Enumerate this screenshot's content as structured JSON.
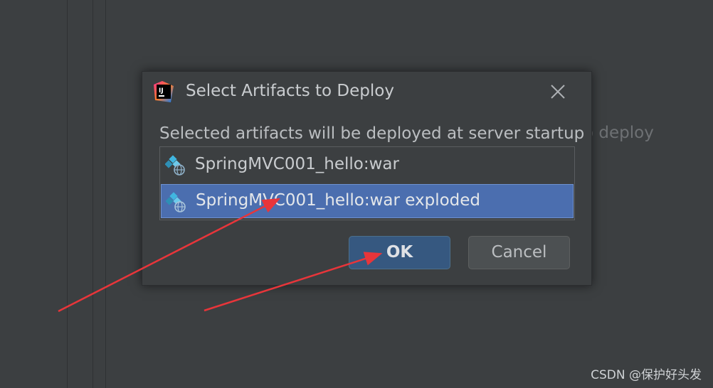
{
  "background": {
    "partial_text": "o deploy"
  },
  "dialog": {
    "title": "Select Artifacts to Deploy",
    "app_icon_text": "IJ",
    "subtitle": "Selected artifacts will be deployed at server startup",
    "artifacts": [
      {
        "label": "SpringMVC001_hello:war",
        "selected": false
      },
      {
        "label": "SpringMVC001_hello:war exploded",
        "selected": true
      }
    ],
    "buttons": {
      "ok": "OK",
      "cancel": "Cancel"
    }
  },
  "watermark": "CSDN @保护好头发",
  "colors": {
    "background": "#3c3f41",
    "selection": "#4b6eaf",
    "default_button": "#365880",
    "annotation_arrow": "#e8353a"
  },
  "icons": {
    "app": "intellij-idea-icon",
    "close": "close-icon",
    "artifact": "web-artifact-icon"
  }
}
